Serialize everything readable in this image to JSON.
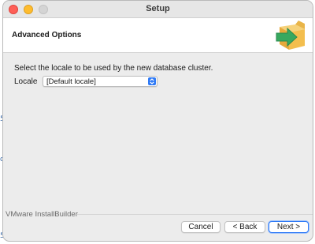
{
  "window": {
    "title": "Setup"
  },
  "header": {
    "title": "Advanced Options",
    "logo_icon": "installer-box-arrow-icon"
  },
  "main": {
    "prompt": "Select the locale to be used by the new database cluster.",
    "locale_label": "Locale",
    "locale_value": "[Default locale]"
  },
  "footer": {
    "brand": "VMware InstallBuilder",
    "cancel_label": "Cancel",
    "back_label": "< Back",
    "next_label": "Next >"
  },
  "background_edge": {
    "chars": [
      "5",
      "d",
      "5"
    ]
  },
  "colors": {
    "accent": "#2f7af6",
    "close": "#fe5f57",
    "minimize": "#febc2e",
    "window_bg": "#ececec"
  }
}
